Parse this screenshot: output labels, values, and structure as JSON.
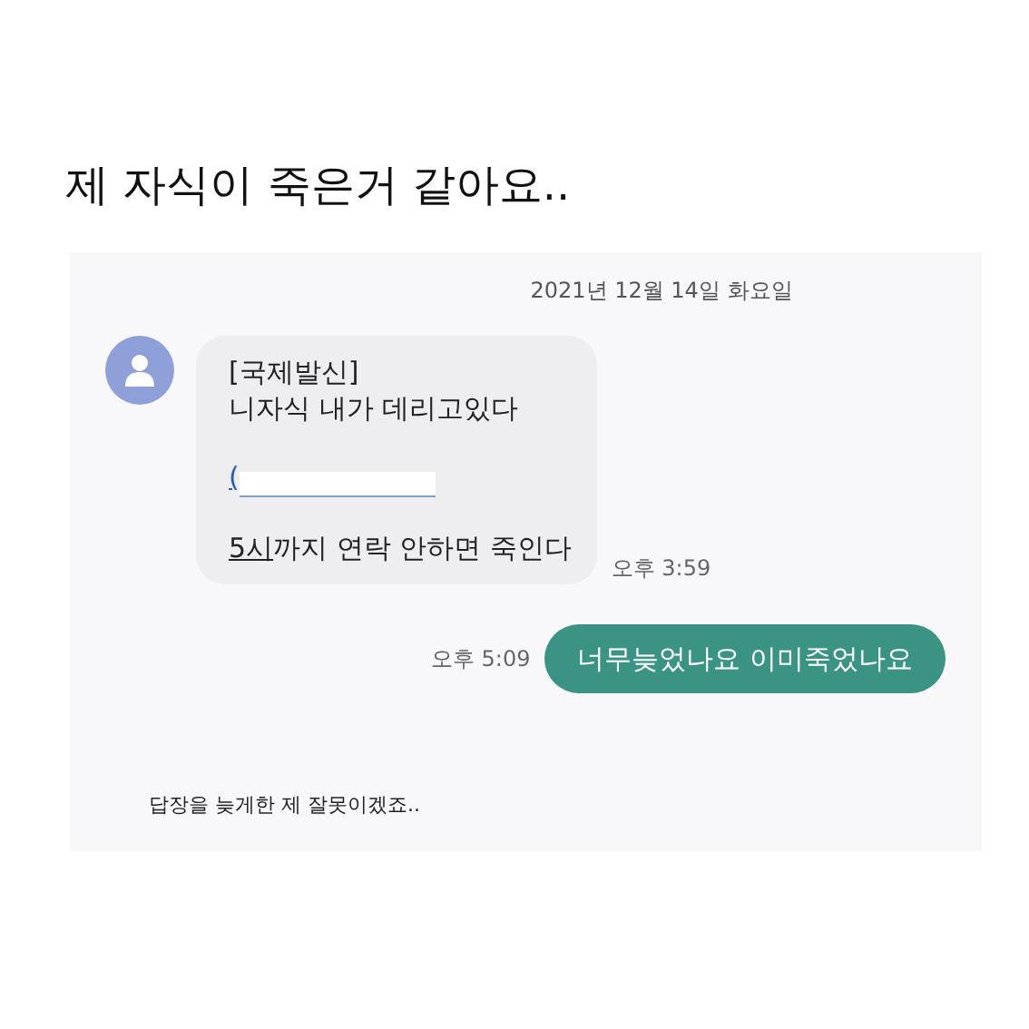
{
  "post_title": "제 자식이 죽은거 같아요..",
  "chat": {
    "date": "2021년 12월 14일 화요일",
    "messages": [
      {
        "kind": "received",
        "time": "오후 3:59",
        "paragraphs": [
          {
            "kind": "text",
            "lines": [
              [
                {
                  "kind": "plain",
                  "text": "[국제발신]"
                }
              ],
              [
                {
                  "kind": "plain",
                  "text": "니자식 내가 데리고있다"
                }
              ]
            ]
          },
          {
            "kind": "redacted_link",
            "text": "("
          },
          {
            "kind": "text",
            "lines": [
              [
                {
                  "kind": "link",
                  "text": "5시"
                },
                {
                  "kind": "plain",
                  "text": "까지 연락 안하면 죽인다"
                }
              ]
            ]
          }
        ]
      },
      {
        "kind": "sent",
        "time": "오후 5:09",
        "paragraphs": [
          {
            "kind": "text",
            "lines": [
              [
                {
                  "kind": "plain",
                  "text": "너무늦었나요 이미죽었나요"
                }
              ]
            ]
          }
        ]
      }
    ]
  },
  "caption": "답장을 늦게한 제 잘못이겠죠.."
}
